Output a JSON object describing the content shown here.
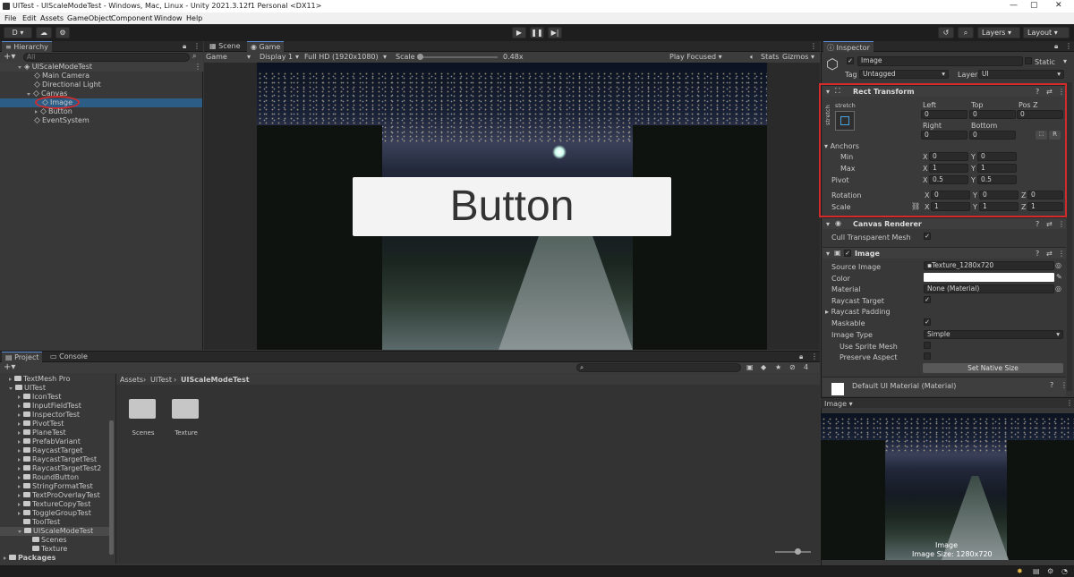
{
  "window": {
    "title": "UITest - UIScaleModeTest - Windows, Mac, Linux - Unity 2021.3.12f1 Personal <DX11>",
    "min": "—",
    "max": "▢",
    "close": "✕"
  },
  "menu": [
    "File",
    "Edit",
    "Assets",
    "GameObject",
    "Component",
    "Window",
    "Help"
  ],
  "toolbar": {
    "account": "D ▾",
    "layers": "Layers",
    "layout": "Layout"
  },
  "hierarchy": {
    "tab": "Hierarchy",
    "search_placeholder": "All",
    "items": [
      {
        "label": "UIScaleModeTest",
        "depth": 0,
        "arrow": "down",
        "icon": "scene"
      },
      {
        "label": "Main Camera",
        "depth": 1,
        "icon": "cube"
      },
      {
        "label": "Directional Light",
        "depth": 1,
        "icon": "cube"
      },
      {
        "label": "Canvas",
        "depth": 1,
        "arrow": "down",
        "icon": "cube"
      },
      {
        "label": "Image",
        "depth": 2,
        "icon": "cube",
        "selected": true
      },
      {
        "label": "Button",
        "depth": 2,
        "arrow": "right",
        "icon": "cube"
      },
      {
        "label": "EventSystem",
        "depth": 1,
        "icon": "cube"
      }
    ]
  },
  "scene_tabs": {
    "scene": "Scene",
    "game": "Game"
  },
  "game_bar": {
    "mode": "Game",
    "display": "Display 1",
    "resolution": "Full HD (1920x1080)",
    "scale_label": "Scale",
    "scale_value": "0.48x",
    "play_focused": "Play Focused",
    "stats": "Stats",
    "gizmos": "Gizmos"
  },
  "game_view": {
    "button_text": "Button"
  },
  "project": {
    "tab_project": "Project",
    "tab_console": "Console",
    "badge": "4",
    "tree": [
      {
        "label": "TextMesh Pro",
        "depth": 1,
        "arrow": "right"
      },
      {
        "label": "UITest",
        "depth": 1,
        "arrow": "down"
      },
      {
        "label": "IconTest",
        "depth": 2,
        "arrow": "right"
      },
      {
        "label": "InputFieldTest",
        "depth": 2,
        "arrow": "right"
      },
      {
        "label": "InspectorTest",
        "depth": 2,
        "arrow": "right"
      },
      {
        "label": "PivotTest",
        "depth": 2,
        "arrow": "right"
      },
      {
        "label": "PlaneTest",
        "depth": 2,
        "arrow": "right"
      },
      {
        "label": "PrefabVariant",
        "depth": 2,
        "arrow": "right"
      },
      {
        "label": "RaycastTarget",
        "depth": 2,
        "arrow": "right"
      },
      {
        "label": "RaycastTargetTest",
        "depth": 2,
        "arrow": "right"
      },
      {
        "label": "RaycastTargetTest2",
        "depth": 2,
        "arrow": "right"
      },
      {
        "label": "RoundButton",
        "depth": 2,
        "arrow": "right"
      },
      {
        "label": "StringFormatTest",
        "depth": 2,
        "arrow": "right"
      },
      {
        "label": "TextProOverlayTest",
        "depth": 2,
        "arrow": "right"
      },
      {
        "label": "TextureCopyTest",
        "depth": 2,
        "arrow": "right"
      },
      {
        "label": "ToggleGroupTest",
        "depth": 2,
        "arrow": "right"
      },
      {
        "label": "ToolTest",
        "depth": 2,
        "arrow": "none"
      },
      {
        "label": "UIScaleModeTest",
        "depth": 2,
        "arrow": "down",
        "selected": true
      },
      {
        "label": "Scenes",
        "depth": 3,
        "arrow": "none"
      },
      {
        "label": "Texture",
        "depth": 3,
        "arrow": "none"
      },
      {
        "label": "Packages",
        "depth": 0,
        "arrow": "right"
      }
    ],
    "breadcrumb": [
      "Assets",
      "UITest",
      "UIScaleModeTest"
    ],
    "assets": [
      "Scenes",
      "Texture"
    ]
  },
  "inspector": {
    "tab": "Inspector",
    "object_name": "Image",
    "static": "Static",
    "tag_label": "Tag",
    "tag_value": "Untagged",
    "layer_label": "Layer",
    "layer_value": "UI",
    "rect": {
      "title": "Rect Transform",
      "stretch": "stretch",
      "left": "Left",
      "top": "Top",
      "posz": "Pos Z",
      "left_v": "0",
      "top_v": "0",
      "posz_v": "0",
      "right": "Right",
      "bottom": "Bottom",
      "right_v": "0",
      "bottom_v": "0",
      "anchors": "Anchors",
      "min": "Min",
      "max": "Max",
      "pivot": "Pivot",
      "rotation": "Rotation",
      "scale": "Scale",
      "min_x": "0",
      "min_y": "0",
      "max_x": "1",
      "max_y": "1",
      "pivot_x": "0.5",
      "pivot_y": "0.5",
      "rot_x": "0",
      "rot_y": "0",
      "rot_z": "0",
      "scale_x": "1",
      "scale_y": "1",
      "scale_z": "1",
      "x": "X",
      "y": "Y",
      "z": "Z",
      "r": "R"
    },
    "canvas_renderer": {
      "title": "Canvas Renderer",
      "cull": "Cull Transparent Mesh"
    },
    "image": {
      "title": "Image",
      "source_image": "Source Image",
      "source_value": "Texture_1280x720",
      "color": "Color",
      "material": "Material",
      "material_value": "None (Material)",
      "raycast_target": "Raycast Target",
      "raycast_padding": "Raycast Padding",
      "maskable": "Maskable",
      "image_type": "Image Type",
      "image_type_value": "Simple",
      "use_sprite_mesh": "Use Sprite Mesh",
      "preserve_aspect": "Preserve Aspect",
      "set_native": "Set Native Size"
    },
    "default_material": "Default UI Material (Material)",
    "preview_label": "Image ▾",
    "preview_caption": "Image",
    "preview_size": "Image Size: 1280x720"
  },
  "colors": {
    "selection": "#2c5d87",
    "highlight": "#d12b2b",
    "accent": "#5a8fd8"
  }
}
